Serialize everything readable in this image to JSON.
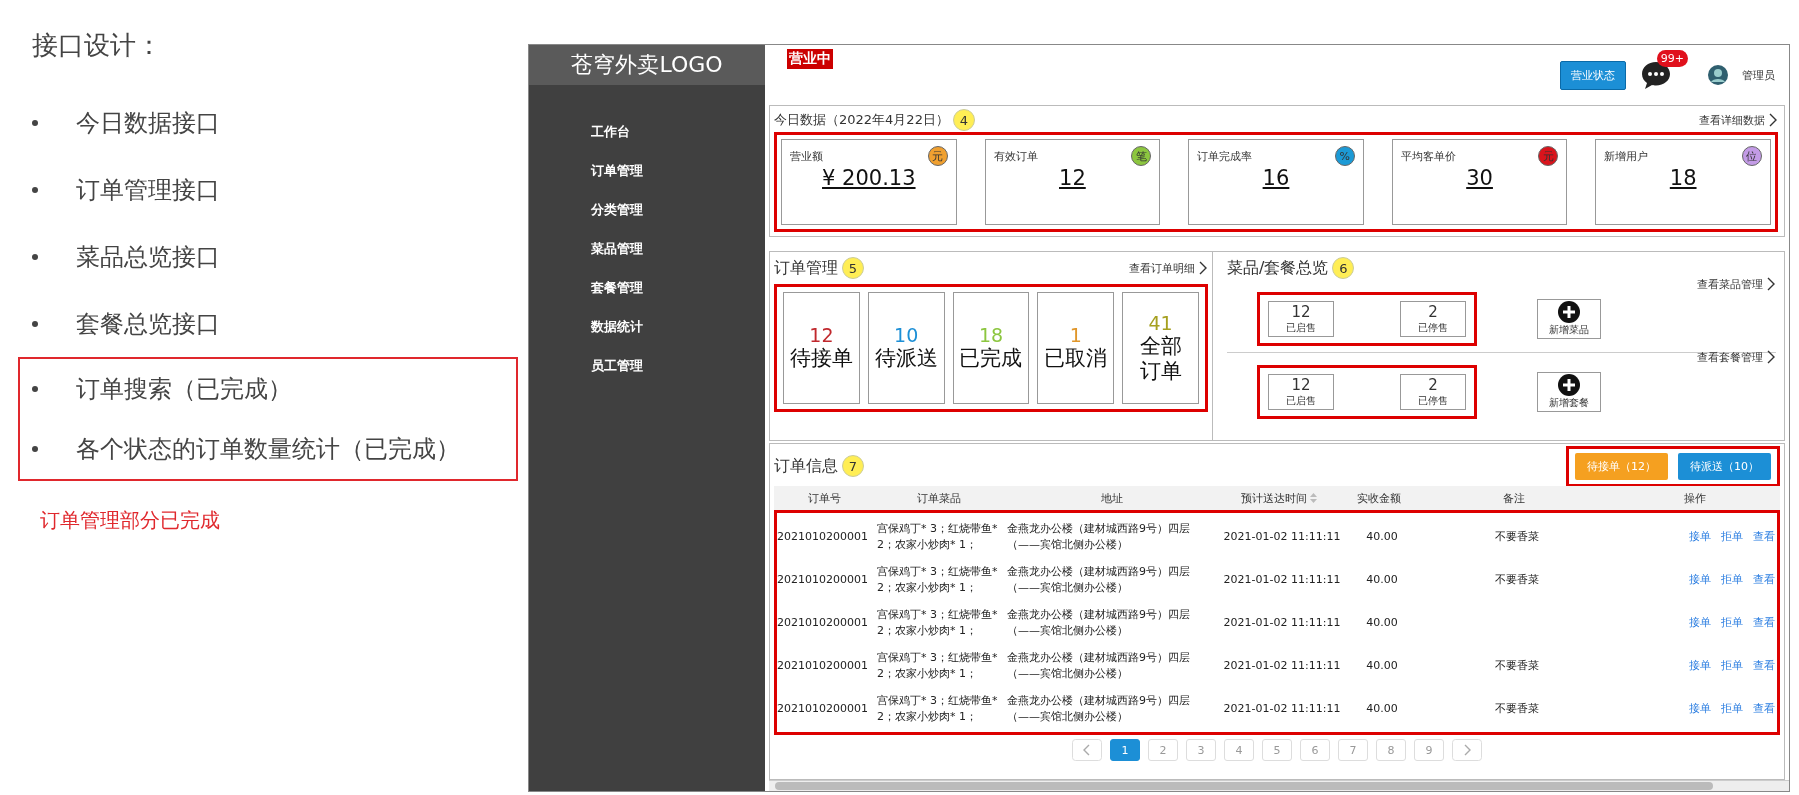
{
  "slide": {
    "title": "接口设计：",
    "bullets": [
      "今日数据接口",
      "订单管理接口",
      "菜品总览接口",
      "套餐总览接口"
    ],
    "highlight_box": {
      "bullets": [
        "订单搜索（已完成）",
        "各个状态的订单数量统计（已完成）"
      ]
    },
    "note": "订单管理部分已完成"
  },
  "app": {
    "logo": "苍穹外卖LOGO",
    "sidebar": [
      {
        "label": "工作台"
      },
      {
        "label": "订单管理"
      },
      {
        "label": "分类管理"
      },
      {
        "label": "菜品管理"
      },
      {
        "label": "套餐管理"
      },
      {
        "label": "数据统计"
      },
      {
        "label": "员工管理"
      }
    ],
    "status_badge": "营业中",
    "status_button": "营业状态",
    "message_count": "99+",
    "user": "管理员",
    "today": {
      "title": "今日数据（2022年4月22日）",
      "marker": "4",
      "link": "查看详细数据",
      "cards": [
        {
          "label": "营业额",
          "value": "¥ 200.13",
          "unit": "元",
          "color": "#f0a030"
        },
        {
          "label": "有效订单",
          "value": "12",
          "unit": "笔",
          "color": "#8cc63f"
        },
        {
          "label": "订单完成率",
          "value": "16",
          "unit": "%",
          "color": "#1c9ad6"
        },
        {
          "label": "平均客单价",
          "value": "30",
          "unit": "元",
          "color": "#d9141c"
        },
        {
          "label": "新增用户",
          "value": "18",
          "unit": "位",
          "color": "#c39be6"
        }
      ]
    },
    "orders": {
      "title": "订单管理",
      "marker": "5",
      "link": "查看订单明细",
      "stats": [
        {
          "count": "12",
          "label": "待接单",
          "color": "#c0282d"
        },
        {
          "count": "10",
          "label": "待派送",
          "color": "#1c8fd6"
        },
        {
          "count": "18",
          "label": "已完成",
          "color": "#8cc63f"
        },
        {
          "count": "1",
          "label": "已取消",
          "color": "#e0962a"
        },
        {
          "count": "41",
          "label": "全部订单",
          "color": "#a6a020"
        }
      ]
    },
    "overview": {
      "title": "菜品/套餐总览",
      "marker": "6",
      "groups": [
        {
          "link": "查看菜品管理",
          "items": [
            {
              "count": "12",
              "label": "已启售"
            },
            {
              "count": "2",
              "label": "已停售"
            }
          ],
          "add": "新增菜品"
        },
        {
          "link": "查看套餐管理",
          "items": [
            {
              "count": "12",
              "label": "已启售"
            },
            {
              "count": "2",
              "label": "已停售"
            }
          ],
          "add": "新增套餐"
        }
      ]
    },
    "order_info": {
      "title": "订单信息",
      "marker": "7",
      "buttons": [
        {
          "label": "待接单（12）",
          "color": "#f5a020"
        },
        {
          "label": "待派送（10）",
          "color": "#1c8fd6"
        }
      ],
      "columns": [
        {
          "label": "订单号",
          "sortable": false
        },
        {
          "label": "订单菜品",
          "sortable": false
        },
        {
          "label": "地址",
          "sortable": false
        },
        {
          "label": "预计送达时间",
          "sortable": true
        },
        {
          "label": "实收金额",
          "sortable": false
        },
        {
          "label": "备注",
          "sortable": false
        },
        {
          "label": "操作",
          "sortable": false
        }
      ],
      "rows": [
        {
          "number": "2021010200001",
          "dishes": "宫保鸡丁* 3；红烧带鱼* 2；农家小炒肉* 1；",
          "address": "金燕龙办公楼（建材城西路9号）四层（——宾馆北侧办公楼）",
          "time": "2021-01-02 11:11:11",
          "amount": "40.00",
          "remark": "不要香菜",
          "actions": [
            "接单",
            "拒单",
            "查看"
          ]
        },
        {
          "number": "2021010200001",
          "dishes": "宫保鸡丁* 3；红烧带鱼* 2；农家小炒肉* 1；",
          "address": "金燕龙办公楼（建材城西路9号）四层（——宾馆北侧办公楼）",
          "time": "2021-01-02 11:11:11",
          "amount": "40.00",
          "remark": "不要香菜",
          "actions": [
            "接单",
            "拒单",
            "查看"
          ]
        },
        {
          "number": "2021010200001",
          "dishes": "宫保鸡丁* 3；红烧带鱼* 2；农家小炒肉* 1；",
          "address": "金燕龙办公楼（建材城西路9号）四层（——宾馆北侧办公楼）",
          "time": "2021-01-02 11:11:11",
          "amount": "40.00",
          "actions": [
            "接单",
            "拒单",
            "查看"
          ]
        },
        {
          "number": "2021010200001",
          "dishes": "宫保鸡丁* 3；红烧带鱼* 2；农家小炒肉* 1；",
          "address": "金燕龙办公楼（建材城西路9号）四层（——宾馆北侧办公楼）",
          "time": "2021-01-02 11:11:11",
          "amount": "40.00",
          "remark": "不要香菜",
          "actions": [
            "接单",
            "拒单",
            "查看"
          ]
        },
        {
          "number": "2021010200001",
          "dishes": "宫保鸡丁* 3；红烧带鱼* 2；农家小炒肉* 1；",
          "address": "金燕龙办公楼（建材城西路9号）四层（——宾馆北侧办公楼）",
          "time": "2021-01-02 11:11:11",
          "amount": "40.00",
          "remark": "不要香菜",
          "actions": [
            "接单",
            "拒单",
            "查看"
          ]
        }
      ]
    },
    "pagination": [
      {
        "label": "1",
        "selected": true
      },
      {
        "label": "2",
        "selected": false
      },
      {
        "label": "3",
        "selected": false
      },
      {
        "label": "4",
        "selected": false
      },
      {
        "label": "5",
        "selected": false
      },
      {
        "label": "6",
        "selected": false
      },
      {
        "label": "7",
        "selected": false
      },
      {
        "label": "8",
        "selected": false
      },
      {
        "label": "9",
        "selected": false
      }
    ]
  }
}
